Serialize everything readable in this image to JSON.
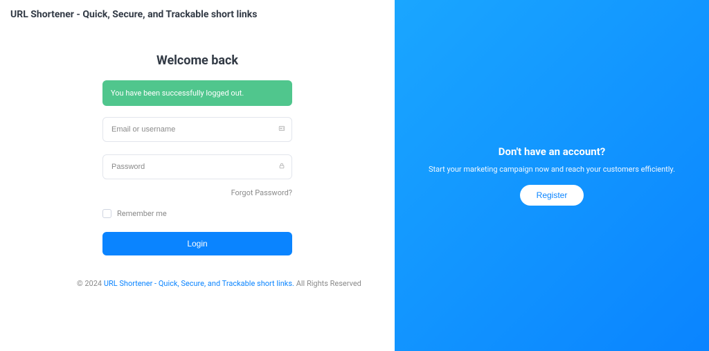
{
  "brand": "URL Shortener - Quick, Secure, and Trackable short links",
  "form": {
    "heading": "Welcome back",
    "alert": "You have been successfully logged out.",
    "email_placeholder": "Email or username",
    "password_placeholder": "Password",
    "forgot": "Forgot Password?",
    "remember": "Remember me",
    "login_label": "Login"
  },
  "footer": {
    "prefix": "© 2024 ",
    "link": "URL Shortener - Quick, Secure, and Trackable short links.",
    "suffix": " All Rights Reserved"
  },
  "right": {
    "heading": "Don't have an account?",
    "text": "Start your marketing campaign now and reach your customers efficiently.",
    "register_label": "Register"
  }
}
